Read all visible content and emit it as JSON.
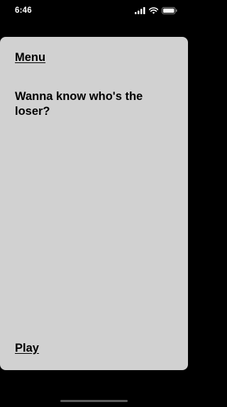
{
  "status_bar": {
    "time": "6:46",
    "icons": [
      "signal-icon",
      "wifi-icon",
      "battery-icon"
    ]
  },
  "screen": {
    "menu_label": "Menu",
    "question_text": "Wanna know who's the loser?",
    "play_label": "Play"
  },
  "colors": {
    "background": "#000000",
    "sheet": "#d1d1d1",
    "text": "#000000",
    "status_text": "#ffffff"
  }
}
